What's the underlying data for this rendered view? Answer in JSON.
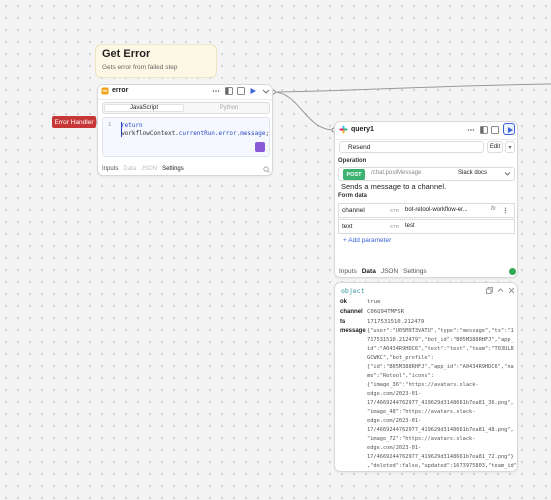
{
  "comment": {
    "title": "Get Error",
    "subtitle": "Gets error from failed step"
  },
  "error_handler_tag": "Error Handler",
  "error_node": {
    "title": "error",
    "tabs_lang": [
      "JavaScript",
      "Python"
    ],
    "line_number": "1",
    "code_line1": "return",
    "code_line2_prefix": "workflowContext.",
    "code_line2_accent": "currentRun.error.message",
    "code_line2_suffix": ";",
    "bottom_tabs": [
      "Inputs",
      "Data",
      "JSON",
      "Settings"
    ]
  },
  "query_node": {
    "title": "query1",
    "resource": "Resend",
    "edit_label": "Edit",
    "operation_label": "Operation",
    "method": "POST",
    "endpoint_path": "/chat.postMessage",
    "docs_label": "Slack docs",
    "description": "Sends a message to a channel.",
    "form_data_label": "Form data",
    "fields": [
      {
        "key": "channel",
        "type": "STR",
        "value": "bot-retool-workflow-er..."
      },
      {
        "key": "text",
        "type": "STR",
        "value": "test"
      }
    ],
    "add_param": "+ Add parameter",
    "tabs": [
      "Inputs",
      "Data",
      "JSON",
      "Settings"
    ],
    "status_color": "#2faa55"
  },
  "data_panel": {
    "type_label": "object",
    "rows": [
      {
        "key": "ok",
        "value": "true"
      },
      {
        "key": "channel",
        "value": "C06Q94TMFSR"
      },
      {
        "key": "ts",
        "value": "1717531510.212479"
      }
    ],
    "message_key": "message",
    "message_lines": [
      "{\"user\":\"U05M9T3VATU\",\"type\":\"message\",\"ts\":\"1",
      "717531510.212479\",\"bot_id\":\"B05M388RHFJ\",\"app_",
      "id\":\"A0434R9HDC6\",\"text\":\"test\",\"team\":\"T03UL8",
      "GCWKC\",\"bot_profile\":",
      "{\"id\":\"B05M388RHFJ\",\"app_id\":\"A0434R9HDC6\",\"na",
      "me\":\"Retool\",\"icons\":",
      "{\"image_36\":\"https://avatars.slack-",
      "edge.com/2023-01-",
      "17/4669244762977_419629d3148661b7ea81_36.png\",",
      "\"image_48\":\"https://avatars.slack-",
      "edge.com/2023-01-",
      "17/4669244762977_419629d3148661b7ea81_48.png\",",
      "\"image_72\":\"https://avatars.slack-",
      "edge.com/2023-01-",
      "17/4669244762977_419629d3148661b7ea81_72.png\"}",
      ",\"deleted\":false,\"updated\":1673975803,\"team_id\""
    ]
  },
  "colors": {
    "accent_blue": "#3a62d9",
    "error_red": "#c83737",
    "post_green": "#3cb371",
    "object_teal": "#2f8f9a",
    "comment_bg": "#fdf8e6"
  }
}
